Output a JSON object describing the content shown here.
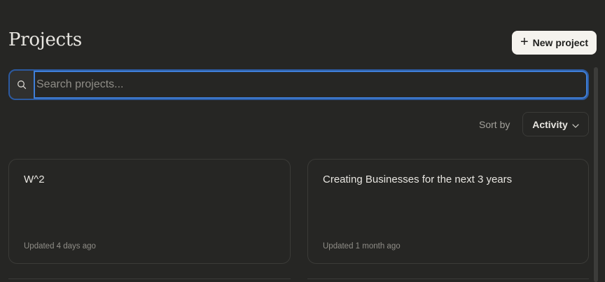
{
  "header": {
    "title": "Projects",
    "new_project_label": "New project"
  },
  "search": {
    "placeholder": "Search projects...",
    "value": ""
  },
  "sort": {
    "label": "Sort by",
    "selected": "Activity"
  },
  "projects": [
    {
      "title": "W^2",
      "updated": "Updated 4 days ago"
    },
    {
      "title": "Creating Businesses for the next 3 years",
      "updated": "Updated 1 month ago"
    }
  ],
  "colors": {
    "background": "#262624",
    "accent_focus": "#3f7fd8",
    "button_bg": "#f5f3ee"
  }
}
